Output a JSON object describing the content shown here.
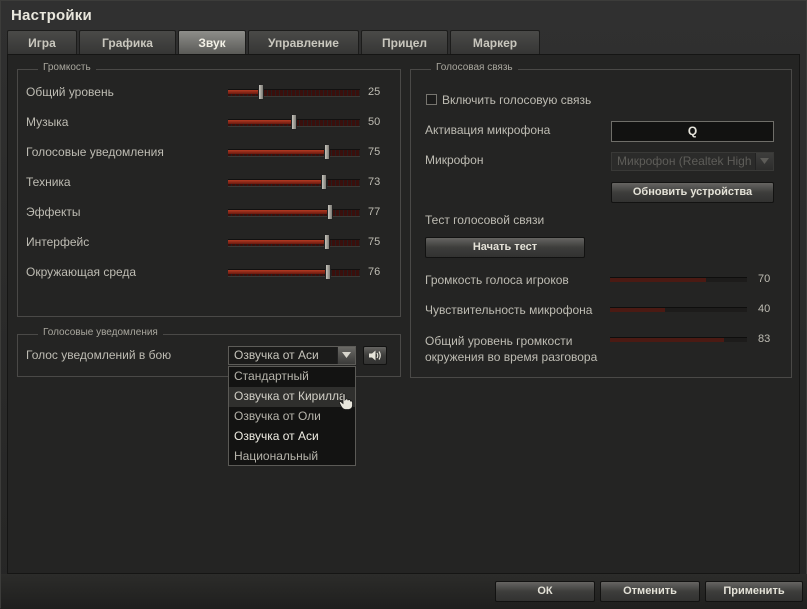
{
  "window": {
    "title": "Настройки"
  },
  "tabs": [
    {
      "label": "Игра",
      "active": false
    },
    {
      "label": "Графика",
      "active": false
    },
    {
      "label": "Звук",
      "active": true
    },
    {
      "label": "Управление",
      "active": false
    },
    {
      "label": "Прицел",
      "active": false
    },
    {
      "label": "Маркер",
      "active": false
    }
  ],
  "volume": {
    "legend": "Громкость",
    "rows": [
      {
        "label": "Общий уровень",
        "value": "25"
      },
      {
        "label": "Музыка",
        "value": "50"
      },
      {
        "label": "Голосовые уведомления",
        "value": "75"
      },
      {
        "label": "Техника",
        "value": "73"
      },
      {
        "label": "Эффекты",
        "value": "77"
      },
      {
        "label": "Интерфейс",
        "value": "75"
      },
      {
        "label": "Окружающая среда",
        "value": "76"
      }
    ]
  },
  "voice_notifications": {
    "legend": "Голосовые уведомления",
    "label": "Голос уведомлений в бою",
    "selected": "Озвучка от Аси",
    "options": [
      "Стандартный",
      "Озвучка от Кирилла",
      "Озвучка от Оли",
      "Озвучка от Аси",
      "Национальный"
    ],
    "hover_index": 1,
    "selected_index": 3
  },
  "voice_chat": {
    "legend": "Голосовая связь",
    "enable_label": "Включить голосовую связь",
    "enabled": false,
    "mic_activation_label": "Активация микрофона",
    "mic_activation_key": "Q",
    "microphone_label": "Микрофон",
    "microphone_value": "Микрофон (Realtek High",
    "refresh_label": "Обновить устройства",
    "test_label": "Тест голосовой связи",
    "start_test_label": "Начать тест",
    "levels": [
      {
        "label": "Громкость голоса игроков",
        "value": "70"
      },
      {
        "label": "Чувствительность микрофона",
        "value": "40"
      },
      {
        "label": "Общий уровень громкости окружения во время разговора",
        "value": "83"
      }
    ]
  },
  "buttons": {
    "ok": "ОК",
    "cancel": "Отменить",
    "apply": "Применить"
  },
  "icons": {
    "sound_preview": "speaker-icon",
    "dropdown": "chevron-down-icon",
    "cursor": "hand-cursor-icon"
  },
  "colors": {
    "accent": "#b33a22",
    "background": "#242423"
  }
}
